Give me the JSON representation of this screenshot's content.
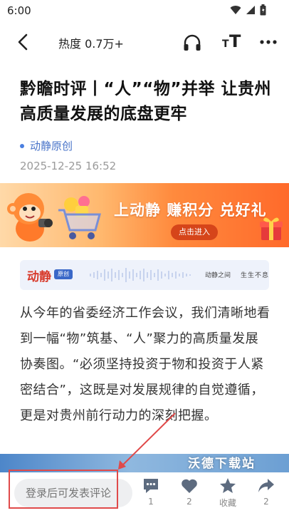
{
  "status_bar": {
    "time": "6:00",
    "icons": [
      "wifi-icon",
      "signal-icon",
      "battery-icon"
    ]
  },
  "nav": {
    "back_icon": "back-arrow-icon",
    "heat_label": "热度 0.7万+",
    "headphones_icon": "headphones-icon",
    "font_size_icon": "font-size-icon",
    "font_small": "T",
    "font_big": "T",
    "more_icon": "more-icon"
  },
  "article": {
    "title": "黔瞻时评丨“人”“物”并举 让贵州高质量发展的底盘更牢",
    "source": "动静原创",
    "publish_time": "2025-12-25 16:52",
    "body": "从今年的省委经济工作会议，我们清晰地看到一幅“物”筑基、“人”聚力的高质量发展协奏图。“必须坚持投资于物和投资于人紧密结合”，这既是对发展规律的自觉遵循，更是对贵州前行动力的深刻把握。"
  },
  "promo": {
    "headline": "上动静 赚积分 兑好礼",
    "button_label": "点击进入",
    "colors": {
      "accent": "#ff8a3d",
      "button": "#d6451a"
    }
  },
  "brand_card": {
    "logo_text": "动静",
    "logo_tag": "原创",
    "slogan_left": "动静之间",
    "slogan_right": "生生不息"
  },
  "image": {
    "watermark": "沃德下载站"
  },
  "bottom_bar": {
    "comment_placeholder": "登录后可发表评论",
    "comment_count": "1",
    "like_count": "2",
    "favorite_label": "收藏",
    "share_count": "2"
  }
}
